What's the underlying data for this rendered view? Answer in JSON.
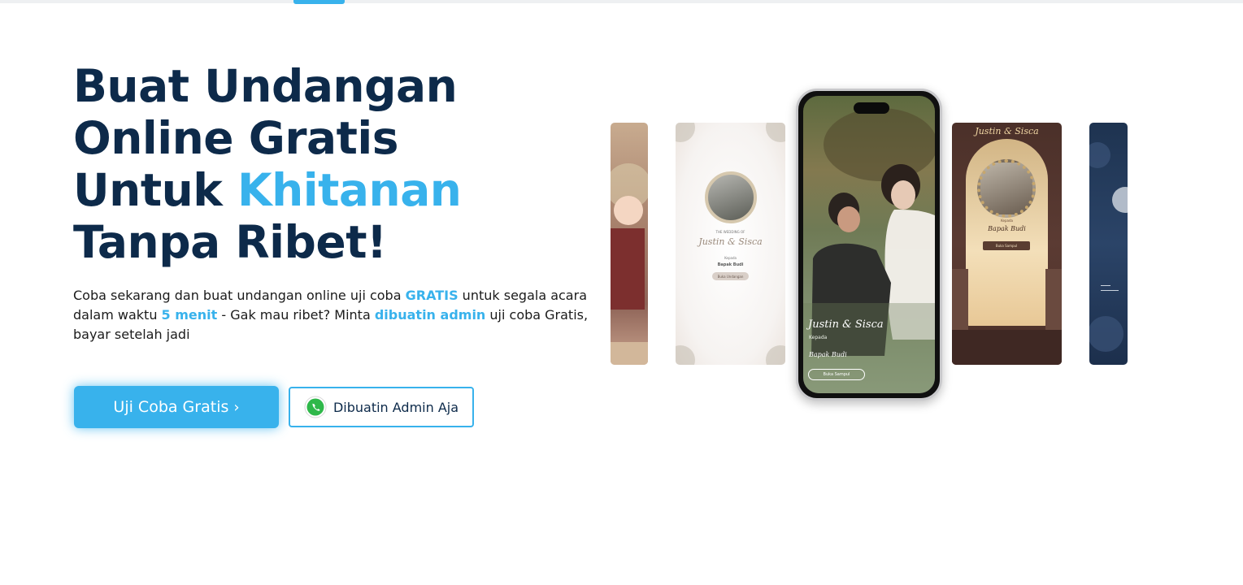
{
  "hero": {
    "title_line1": "Buat Undangan",
    "title_line2": "Online Gratis",
    "title_line3_pre": "Untuk ",
    "title_line3_highlight": "Khitanan",
    "title_line4": "Tanpa Ribet!",
    "description": {
      "part1": "Coba sekarang dan buat undangan online uji coba ",
      "highlight1": "GRATIS",
      "part2": " untuk segala acara dalam waktu ",
      "highlight2": "5 menit",
      "part3": " - Gak mau ribet? Minta ",
      "highlight3": "dibuatin admin",
      "part4": " uji coba Gratis, bayar setelah jadi"
    },
    "primary_button": {
      "label": "Uji Coba Gratis",
      "chevron": "›"
    },
    "secondary_button": {
      "label": "Dibuatin Admin Aja",
      "icon": "whatsapp-icon"
    }
  },
  "preview": {
    "phone": {
      "couple": "Justin & Sisca",
      "kepada": "Kepada",
      "guest": "Bapak Budi",
      "button": "Buka Sampul"
    },
    "card_white": {
      "wedding_of": "THE WEDDING OF",
      "couple": "Justin & Sisca",
      "kepada": "Kepada",
      "guest": "Bapak Budi",
      "button": "Buka Undangan"
    },
    "card_brown": {
      "couple": "Justin & Sisca",
      "kepada": "Kepada",
      "guest": "Bapak Budi",
      "button": "Buka Sampul"
    }
  },
  "colors": {
    "accent": "#38b2ec",
    "heading": "#0d2a4a",
    "text": "#1b1b1b"
  }
}
